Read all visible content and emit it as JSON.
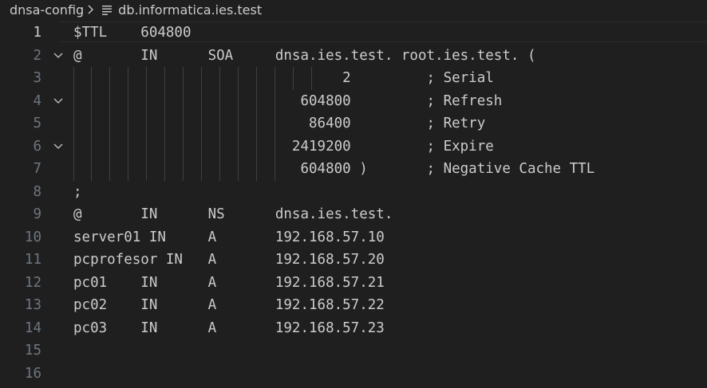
{
  "breadcrumb": {
    "folder": "dnsa-config",
    "file": "db.informatica.ies.test",
    "icons": [
      "chevron-right-icon",
      "file-lines-icon"
    ]
  },
  "editor": {
    "active_line": 1,
    "lines": [
      {
        "num": "1",
        "text": "$TTL    604800",
        "fold": false
      },
      {
        "num": "2",
        "text": "@       IN      SOA     dnsa.ies.test. root.ies.test. (",
        "fold": true
      },
      {
        "num": "3",
        "text": "                                2         ; Serial",
        "fold": false
      },
      {
        "num": "4",
        "text": "                           604800         ; Refresh",
        "fold": true
      },
      {
        "num": "5",
        "text": "                            86400         ; Retry",
        "fold": false
      },
      {
        "num": "6",
        "text": "                          2419200         ; Expire",
        "fold": true
      },
      {
        "num": "7",
        "text": "                           604800 )       ; Negative Cache TTL",
        "fold": false
      },
      {
        "num": "8",
        "text": ";",
        "fold": false
      },
      {
        "num": "9",
        "text": "@       IN      NS      dnsa.ies.test.",
        "fold": false
      },
      {
        "num": "10",
        "text": "server01 IN     A       192.168.57.10",
        "fold": false
      },
      {
        "num": "11",
        "text": "pcprofesor IN   A       192.168.57.20",
        "fold": false
      },
      {
        "num": "12",
        "text": "pc01    IN      A       192.168.57.21",
        "fold": false
      },
      {
        "num": "13",
        "text": "pc02    IN      A       192.168.57.22",
        "fold": false
      },
      {
        "num": "14",
        "text": "pc03    IN      A       192.168.57.23",
        "fold": false
      },
      {
        "num": "15",
        "text": "",
        "fold": false
      },
      {
        "num": "16",
        "text": "",
        "fold": false
      }
    ]
  },
  "colors": {
    "background": "#1f1f1f",
    "text": "#cccccc",
    "line_number": "#6e7681",
    "indent_guide": "#404040"
  }
}
